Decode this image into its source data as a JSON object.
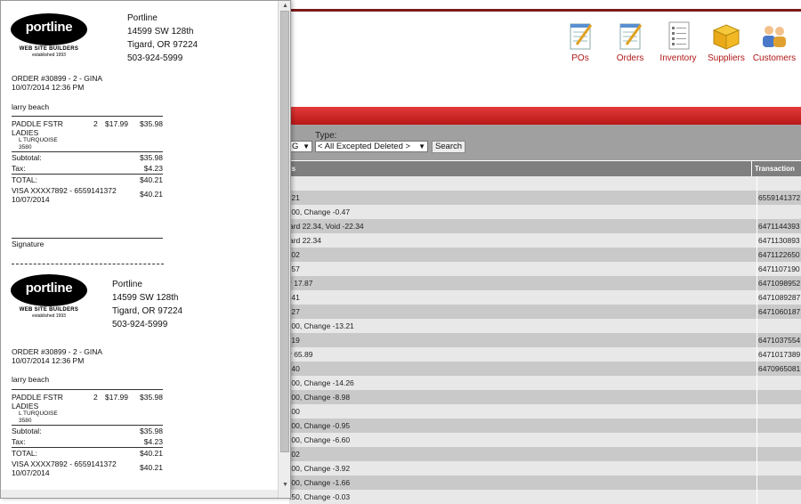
{
  "toolbar": {
    "items": [
      {
        "label": "POs",
        "icon": "pos-notepad-icon"
      },
      {
        "label": "Orders",
        "icon": "orders-notepad-icon"
      },
      {
        "label": "Inventory",
        "icon": "inventory-list-icon"
      },
      {
        "label": "Suppliers",
        "icon": "suppliers-box-icon"
      },
      {
        "label": "Customers",
        "icon": "customers-people-icon"
      }
    ]
  },
  "filters": {
    "type_label": "Type:",
    "partial_select_value": "G",
    "type_select_value": "< All Excepted Deleted >",
    "search_label": "Search"
  },
  "grid": {
    "header_left": "ts",
    "header_right": "Transaction",
    "rows": [
      {
        "payment": "",
        "transaction": ""
      },
      {
        "payment": ".21",
        "transaction": "6559141372"
      },
      {
        "payment": ".00, Change -0.47",
        "transaction": ""
      },
      {
        "payment": "ard 22.34, Void -22.34",
        "transaction": "6471144393"
      },
      {
        "payment": "ard 22.34",
        "transaction": "6471130893"
      },
      {
        "payment": ".02",
        "transaction": "6471122650"
      },
      {
        "payment": ".57",
        "transaction": "6471107190"
      },
      {
        "payment": "r 17.87",
        "transaction": "6471098952"
      },
      {
        "payment": ".41",
        "transaction": "6471089287"
      },
      {
        "payment": ".27",
        "transaction": "6471060187"
      },
      {
        "payment": ".00, Change -13.21",
        "transaction": ""
      },
      {
        "payment": ".19",
        "transaction": "6471037554"
      },
      {
        "payment": "r 65.89",
        "transaction": "6471017389"
      },
      {
        "payment": ".40",
        "transaction": "6470965081"
      },
      {
        "payment": ".00, Change -14.26",
        "transaction": ""
      },
      {
        "payment": ".00, Change -8.98",
        "transaction": ""
      },
      {
        "payment": ".00",
        "transaction": ""
      },
      {
        "payment": ".00, Change -0.95",
        "transaction": ""
      },
      {
        "payment": ".00, Change -6.60",
        "transaction": ""
      },
      {
        "payment": ".02",
        "transaction": ""
      },
      {
        "payment": ".00, Change -3.92",
        "transaction": ""
      },
      {
        "payment": ".00, Change -1.66",
        "transaction": ""
      },
      {
        "payment": ".50, Change -0.03",
        "transaction": ""
      }
    ]
  },
  "receipt": {
    "logo_word": "portline",
    "logo_sub": "WEB SITE BUILDERS",
    "logo_est": "established 1993",
    "company": "Portline",
    "street": "14599 SW 128th",
    "city": "Tigard, OR 97224",
    "phone": "503-924-5999",
    "order_line": "ORDER #30899 - 2 - GINA",
    "order_datetime": "10/07/2014 12:36 PM",
    "customer": "larry beach",
    "item_name_1": "PADDLE FSTR",
    "item_name_2": "LADIES",
    "item_qty": "2",
    "item_price": "$17.99",
    "item_total": "$35.98",
    "item_variant": "L TURQUOISE",
    "item_code": "3580",
    "subtotal_label": "Subtotal:",
    "subtotal": "$35.98",
    "tax_label": "Tax:",
    "tax": "$4.23",
    "total_label": "TOTAL:",
    "total": "$40.21",
    "payment_line": "VISA XXXX7892 - 6559141372",
    "payment_date": "10/07/2014",
    "payment_amount": "$40.21",
    "signature_label": "Signature"
  }
}
